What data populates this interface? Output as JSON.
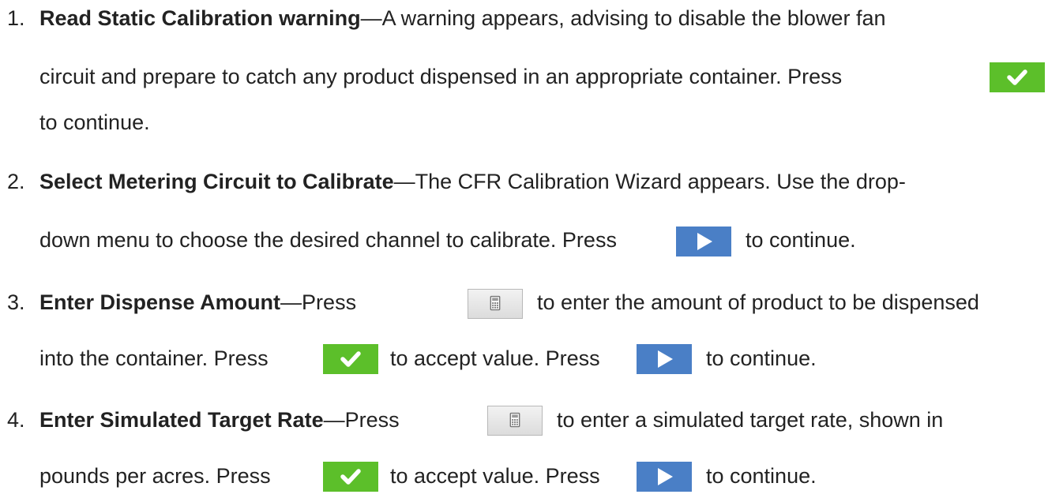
{
  "steps": [
    {
      "number": "1.",
      "title": "Read Static Calibration warning",
      "line1": "—A warning appears, advising to disable the blower fan",
      "line2": "circuit and prepare to catch any product dispensed in an appropriate container. Press",
      "line3": "to continue."
    },
    {
      "number": "2.",
      "title": "Select Metering Circuit to Calibrate",
      "line1": "—The CFR Calibration Wizard appears. Use the drop-",
      "line2a": "down menu to choose the desired channel to calibrate. Press",
      "line2b": "to continue."
    },
    {
      "number": "3.",
      "title": "Enter Dispense Amount",
      "line1a": "—Press",
      "line1b": "to enter the amount of product to be dispensed",
      "line2a": "into the container. Press",
      "line2b": "to accept value. Press",
      "line2c": "to continue."
    },
    {
      "number": "4.",
      "title": "Enter Simulated Target Rate",
      "line1a": "—Press",
      "line1b": "to enter a simulated target rate, shown in",
      "line2a": "pounds per acres. Press",
      "line2b": "to accept value. Press",
      "line2c": "to continue."
    }
  ],
  "icons": {
    "accept": "checkmark-icon",
    "next": "play-arrow-icon",
    "calculator": "calculator-icon"
  },
  "colors": {
    "accept_button": "#5cbf2a",
    "next_button": "#4a7fc6",
    "calculator_button": "#e6e6e6"
  }
}
